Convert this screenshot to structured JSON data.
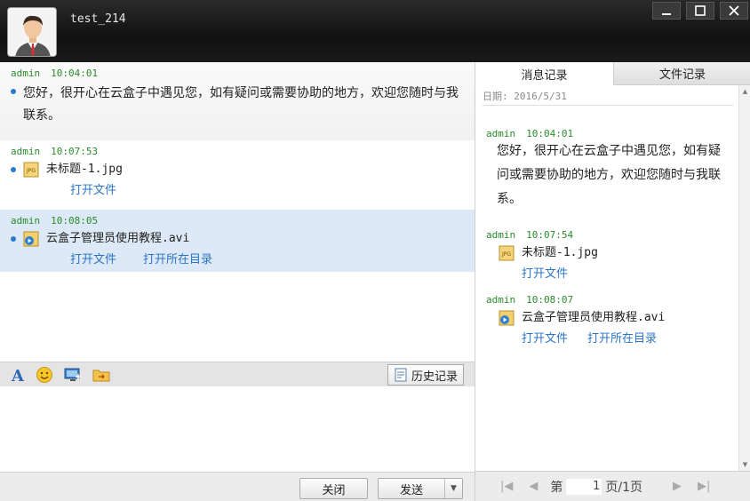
{
  "window": {
    "username": "test_214",
    "controls": {
      "minimize": "—",
      "maximize": "☐",
      "close": "✕"
    }
  },
  "chat": {
    "messages": [
      {
        "sender": "admin",
        "time": "10:04:01",
        "text": "您好，很开心在云盒子中遇见您，如有疑问或需要协助的地方，欢迎您随时与我联系。"
      },
      {
        "sender": "admin",
        "time": "10:07:53",
        "file": "未标题-1.jpg",
        "file_icon": "jpg-file-icon",
        "links": [
          "打开文件"
        ]
      },
      {
        "sender": "admin",
        "time": "10:08:05",
        "file": "云盒子管理员使用教程.avi",
        "file_icon": "video-file-icon",
        "links": [
          "打开文件",
          "打开所在目录"
        ]
      }
    ]
  },
  "toolbar": {
    "icons": [
      "font-icon",
      "emoji-icon",
      "screenshot-icon",
      "folder-icon"
    ],
    "history_label": "历史记录"
  },
  "bottom": {
    "close_label": "关闭",
    "send_label": "发送",
    "send_arrow": "▼"
  },
  "right": {
    "tabs": [
      {
        "label": "消息记录",
        "active": true
      },
      {
        "label": "文件记录",
        "active": false
      }
    ],
    "date": "日期: 2016/5/31",
    "messages": [
      {
        "sender": "admin",
        "time": "10:04:01",
        "text": "您好，很开心在云盒子中遇见您，如有疑问或需要协助的地方，欢迎您随时与我联系。"
      },
      {
        "sender": "admin",
        "time": "10:07:54",
        "file": "未标题-1.jpg",
        "links": [
          "打开文件"
        ]
      },
      {
        "sender": "admin",
        "time": "10:08:07",
        "file": "云盒子管理员使用教程.avi",
        "links": [
          "打开文件",
          "打开所在目录"
        ]
      }
    ],
    "pager": {
      "first": "|◀",
      "prev": "◀",
      "label_pre": "第",
      "page": "1",
      "label_post": "页/1页",
      "next": "▶",
      "last": "▶|"
    }
  },
  "colors": {
    "accent_link": "#2b75c8",
    "meta_green": "#2b8a2b",
    "selected_row": "#dde9f6"
  }
}
